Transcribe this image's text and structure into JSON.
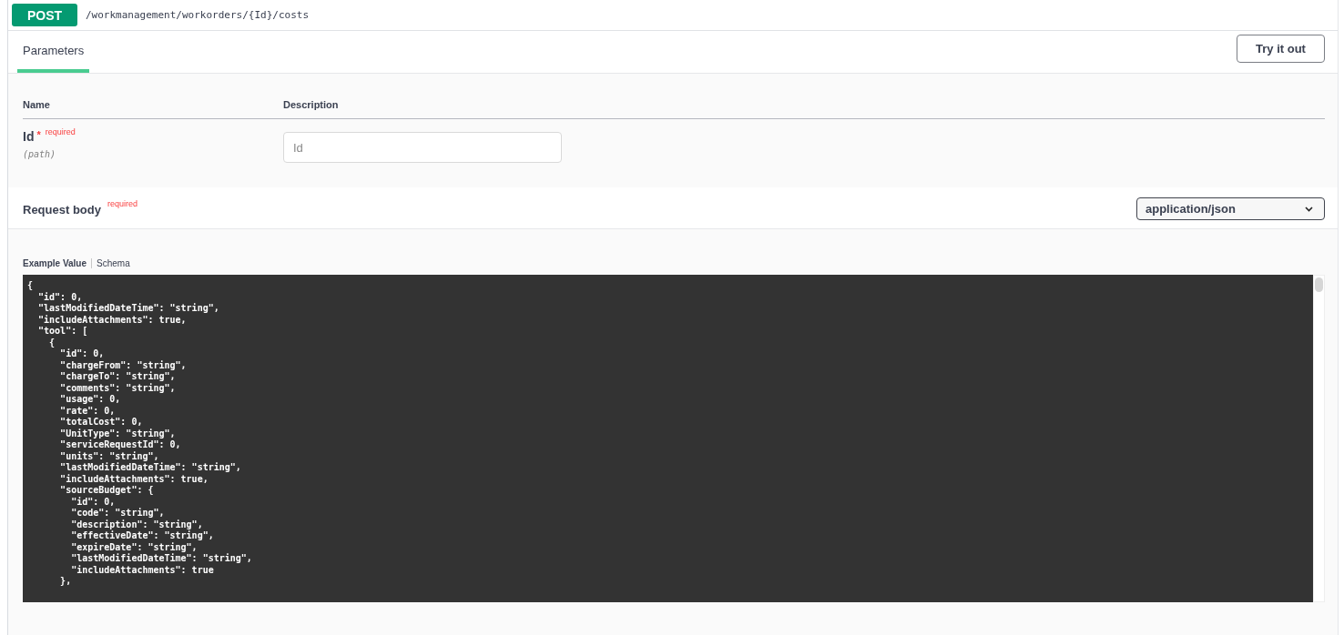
{
  "operation": {
    "method": "POST",
    "path": "/workmanagement/workorders/{Id}/costs"
  },
  "tabs": [
    {
      "label": "Parameters",
      "selected": true
    }
  ],
  "try_button": "Try it out",
  "parameters": {
    "columns": [
      "Name",
      "Description"
    ],
    "rows": [
      {
        "name": "Id",
        "star": "*",
        "required": "required",
        "location": "(path)",
        "placeholder": "Id"
      }
    ]
  },
  "request_body": {
    "title": "Request body",
    "required": "required",
    "content_type": "application/json"
  },
  "example_tabs": [
    {
      "label": "Example Value",
      "selected": true
    },
    {
      "label": "Schema",
      "selected": false
    }
  ],
  "example_code": "{\n  \"id\": 0,\n  \"lastModifiedDateTime\": \"string\",\n  \"includeAttachments\": true,\n  \"tool\": [\n    {\n      \"id\": 0,\n      \"chargeFrom\": \"string\",\n      \"chargeTo\": \"string\",\n      \"comments\": \"string\",\n      \"usage\": 0,\n      \"rate\": 0,\n      \"totalCost\": 0,\n      \"UnitType\": \"string\",\n      \"serviceRequestId\": 0,\n      \"units\": \"string\",\n      \"lastModifiedDateTime\": \"string\",\n      \"includeAttachments\": true,\n      \"sourceBudget\": {\n        \"id\": 0,\n        \"code\": \"string\",\n        \"description\": \"string\",\n        \"effectiveDate\": \"string\",\n        \"expireDate\": \"string\",\n        \"lastModifiedDateTime\": \"string\",\n        \"includeAttachments\": true\n      },"
}
